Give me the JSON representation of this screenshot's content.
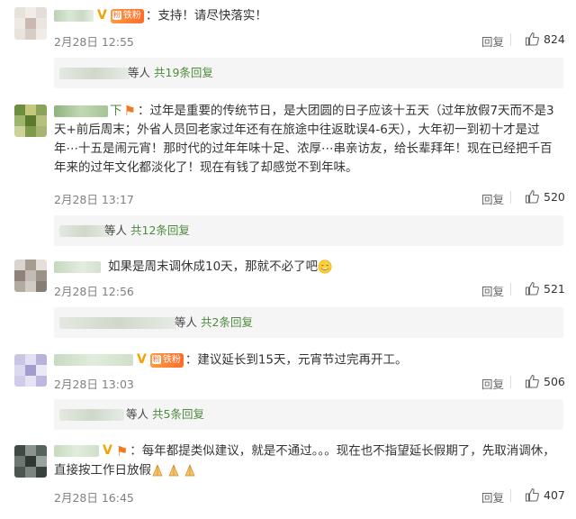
{
  "comments": [
    {
      "text": "：支持！请尽快落实！",
      "time": "2月28日 12:55",
      "reply": "回复",
      "likes": "824",
      "sub": {
        "prefix": "等人",
        "link": "共19条回复"
      }
    },
    {
      "text": "：过年是重要的传统节日，是大团圆的日子应该十五天（过年放假7天而不是3天+前后周末；外省人员回老家过年还有在旅途中往返耽误4-6天），大年初一到初十才是过年⋯十五是闹元宵！那时代的过年年味十足、浓厚⋯串亲访友，给长辈拜年！现在已经把千百年来的过年文化都淡化了！现在有钱了却感觉不到年味。",
      "time": "2月28日 13:17",
      "reply": "回复",
      "likes": "520",
      "sub": {
        "prefix": "等人",
        "link": "共12条回复"
      }
    },
    {
      "text": "如果是周末调休成10天，那就不必了吧",
      "time": "2月28日 12:56",
      "reply": "回复",
      "likes": "521",
      "sub": {
        "prefix": "等人",
        "link": "共2条回复"
      }
    },
    {
      "text": "：建议延长到15天，元宵节过完再开工。",
      "time": "2月28日 13:03",
      "reply": "回复",
      "likes": "506",
      "sub": {
        "prefix": "等人",
        "link": "共5条回复"
      }
    },
    {
      "text": "：每年都提类似建议，就是不通过。。。现在也不指望延长假期了，先取消调休，直接按工作日放假",
      "time": "2月28日 16:45",
      "reply": "回复",
      "likes": "407"
    }
  ],
  "badges": {
    "fan_label": "铁粉",
    "verified_mark": "V",
    "name_suffix_1": "下"
  },
  "icons": {
    "like": "thumbs-up-icon",
    "emoji_1": "sweat-smile-emoji",
    "emoji_2": "praying-hands-emoji"
  },
  "colors": {
    "link": "#4f8a3e",
    "muted": "#808080",
    "badge": "#ff7a2b",
    "verified": "#f2a300"
  }
}
